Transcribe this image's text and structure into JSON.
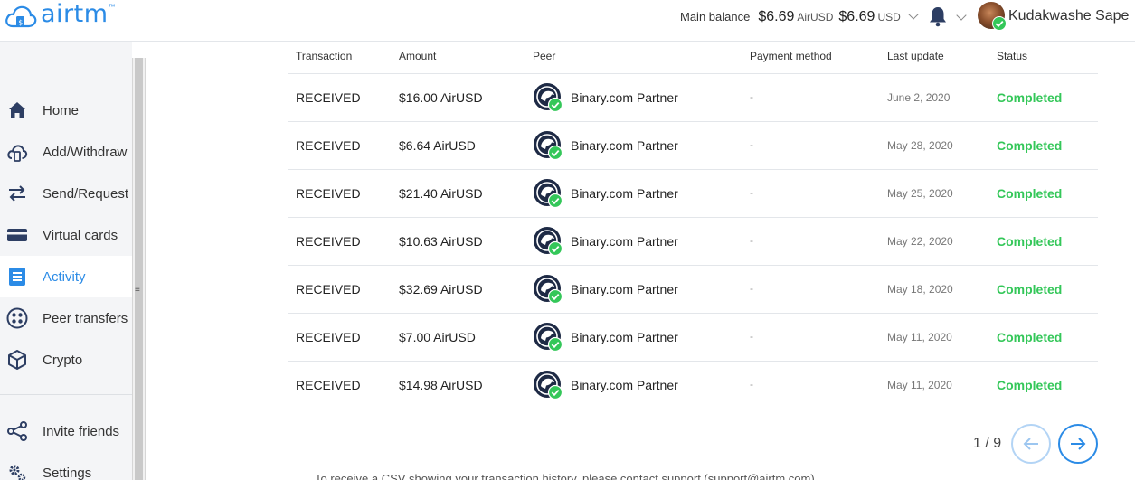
{
  "brand": {
    "name": "airtm",
    "tm": "™"
  },
  "header": {
    "balance_label": "Main balance",
    "airusd_amount": "$6.69",
    "airusd_currency": "AirUSD",
    "usd_amount": "$6.69",
    "usd_currency": "USD",
    "username": "Kudakwashe Sape"
  },
  "sidebar": {
    "items": [
      {
        "label": "Home",
        "icon": "home-icon"
      },
      {
        "label": "Add/Withdraw",
        "icon": "cloud-money-icon"
      },
      {
        "label": "Send/Request",
        "icon": "transfer-arrows-icon"
      },
      {
        "label": "Virtual cards",
        "icon": "card-icon"
      },
      {
        "label": "Activity",
        "icon": "activity-list-icon",
        "active": true
      },
      {
        "label": "Peer transfers",
        "icon": "peer-circles-icon"
      },
      {
        "label": "Crypto",
        "icon": "cube-icon"
      },
      {
        "label": "Invite friends",
        "icon": "share-icon"
      },
      {
        "label": "Settings",
        "icon": "gear-icon"
      }
    ]
  },
  "table": {
    "headers": {
      "transaction": "Transaction",
      "amount": "Amount",
      "peer": "Peer",
      "payment_method": "Payment method",
      "last_update": "Last update",
      "status": "Status"
    },
    "rows": [
      {
        "type": "RECEIVED",
        "amount": "$16.00 AirUSD",
        "peer": "Binary.com Partner",
        "method": "-",
        "date": "June 2, 2020",
        "status": "Completed"
      },
      {
        "type": "RECEIVED",
        "amount": "$6.64 AirUSD",
        "peer": "Binary.com Partner",
        "method": "-",
        "date": "May 28, 2020",
        "status": "Completed"
      },
      {
        "type": "RECEIVED",
        "amount": "$21.40 AirUSD",
        "peer": "Binary.com Partner",
        "method": "-",
        "date": "May 25, 2020",
        "status": "Completed"
      },
      {
        "type": "RECEIVED",
        "amount": "$10.63 AirUSD",
        "peer": "Binary.com Partner",
        "method": "-",
        "date": "May 22, 2020",
        "status": "Completed"
      },
      {
        "type": "RECEIVED",
        "amount": "$32.69 AirUSD",
        "peer": "Binary.com Partner",
        "method": "-",
        "date": "May 18, 2020",
        "status": "Completed"
      },
      {
        "type": "RECEIVED",
        "amount": "$7.00 AirUSD",
        "peer": "Binary.com Partner",
        "method": "-",
        "date": "May 11, 2020",
        "status": "Completed"
      },
      {
        "type": "RECEIVED",
        "amount": "$14.98 AirUSD",
        "peer": "Binary.com Partner",
        "method": "-",
        "date": "May 11, 2020",
        "status": "Completed"
      }
    ]
  },
  "pagination": {
    "label": "1 / 9"
  },
  "footer": {
    "text": "To receive a CSV showing your transaction history, please contact support (support@airtm.com)"
  },
  "colors": {
    "brand_blue": "#2b8be6",
    "status_green": "#34c759",
    "sidebar_bg": "#f4f5f7"
  }
}
